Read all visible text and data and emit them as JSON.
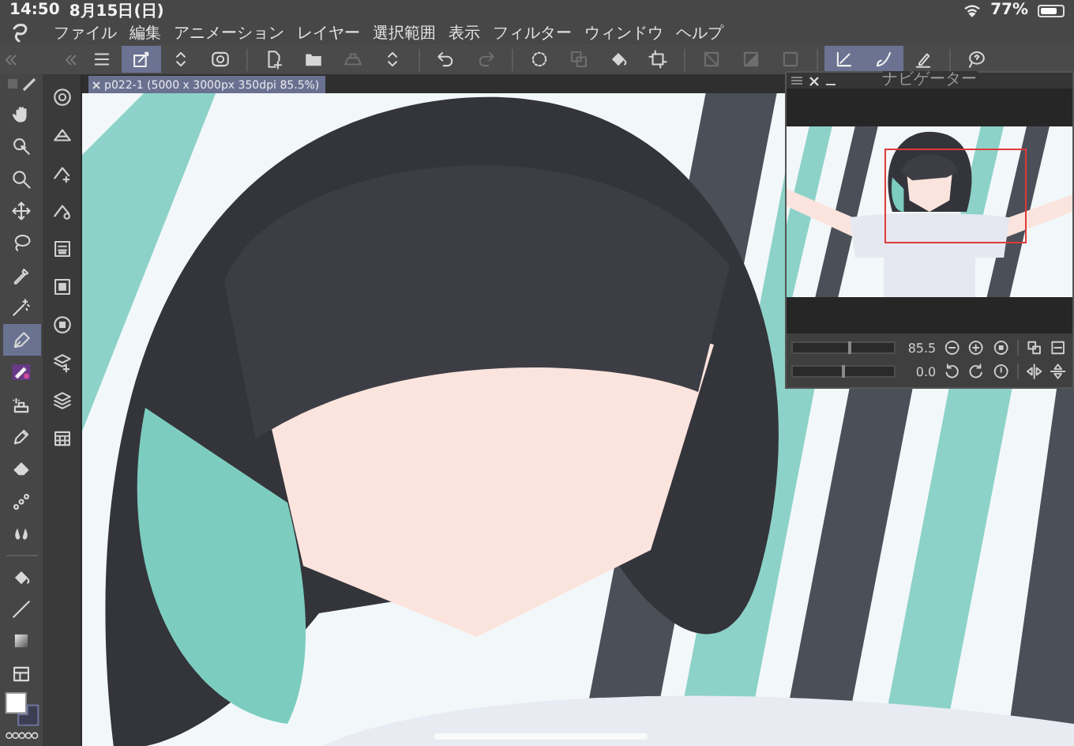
{
  "status_bar": {
    "time": "14:50",
    "date": "8月15日(日)",
    "battery": "77%"
  },
  "menu": [
    "ファイル",
    "編集",
    "アニメーション",
    "レイヤー",
    "選択範囲",
    "表示",
    "フィルター",
    "ウィンドウ",
    "ヘルプ"
  ],
  "toolbar": [
    {
      "kind": "menu",
      "selected": false,
      "disabled": false
    },
    {
      "kind": "transform",
      "selected": true,
      "disabled": false
    },
    {
      "kind": "updown",
      "selected": false,
      "disabled": false
    },
    {
      "kind": "record",
      "selected": false,
      "disabled": false
    },
    {
      "kind": "separator"
    },
    {
      "kind": "newdoc",
      "selected": false,
      "disabled": false
    },
    {
      "kind": "folder",
      "selected": false,
      "disabled": false
    },
    {
      "kind": "tray",
      "selected": false,
      "disabled": true
    },
    {
      "kind": "updown",
      "selected": false,
      "disabled": false
    },
    {
      "kind": "separator"
    },
    {
      "kind": "undo",
      "selected": false,
      "disabled": false
    },
    {
      "kind": "redo",
      "selected": false,
      "disabled": true
    },
    {
      "kind": "separator"
    },
    {
      "kind": "dotcircle",
      "selected": false,
      "disabled": false
    },
    {
      "kind": "layerstack",
      "selected": false,
      "disabled": true
    },
    {
      "kind": "bucket",
      "selected": false,
      "disabled": false
    },
    {
      "kind": "crop",
      "selected": false,
      "disabled": false
    },
    {
      "kind": "separator"
    },
    {
      "kind": "squarediag",
      "selected": false,
      "disabled": true
    },
    {
      "kind": "squaregrad",
      "selected": false,
      "disabled": true
    },
    {
      "kind": "squareplain",
      "selected": false,
      "disabled": true
    },
    {
      "kind": "separator"
    },
    {
      "kind": "pencheck",
      "selected": true,
      "disabled": false
    },
    {
      "kind": "brushcheck",
      "selected": true,
      "disabled": false
    },
    {
      "kind": "penline",
      "selected": false,
      "disabled": false
    },
    {
      "kind": "separator"
    },
    {
      "kind": "lassohelp",
      "selected": false,
      "disabled": false
    }
  ],
  "tools": [
    {
      "kind": "hand",
      "selected": false
    },
    {
      "kind": "selzoom",
      "selected": false
    },
    {
      "kind": "magnifier",
      "selected": false
    },
    {
      "kind": "move",
      "selected": false
    },
    {
      "kind": "lasso",
      "selected": false
    },
    {
      "kind": "eyedropper",
      "selected": false
    },
    {
      "kind": "wand",
      "selected": false
    },
    {
      "kind": "pen",
      "selected": true
    },
    {
      "kind": "brushthumb",
      "selected": false
    },
    {
      "kind": "airbrush",
      "selected": false
    },
    {
      "kind": "pencil",
      "selected": false
    },
    {
      "kind": "eraser",
      "selected": false
    },
    {
      "kind": "chain",
      "selected": false
    },
    {
      "kind": "drops",
      "selected": false
    },
    {
      "kind": "separator"
    },
    {
      "kind": "bucket",
      "selected": false
    },
    {
      "kind": "line",
      "selected": false
    },
    {
      "kind": "gradient",
      "selected": false
    },
    {
      "kind": "frame",
      "selected": false
    }
  ],
  "commands": [
    {
      "kind": "target"
    },
    {
      "kind": "layerfill"
    },
    {
      "kind": "layeradd"
    },
    {
      "kind": "layergear"
    },
    {
      "kind": "layersquare"
    },
    {
      "kind": "film"
    },
    {
      "kind": "circlesquare"
    },
    {
      "kind": "stackplus"
    },
    {
      "kind": "stack"
    },
    {
      "kind": "grid"
    }
  ],
  "document_tab": {
    "title": "p022-1 (5000 x 3000px 350dpi 85.5%)"
  },
  "navigator": {
    "title": "ナビゲーター",
    "sliders": [
      {
        "kind": "zoom",
        "reading": "85.5",
        "level": 0.56
      },
      {
        "kind": "rotate",
        "reading": "0.0",
        "level": 0.5
      }
    ]
  }
}
